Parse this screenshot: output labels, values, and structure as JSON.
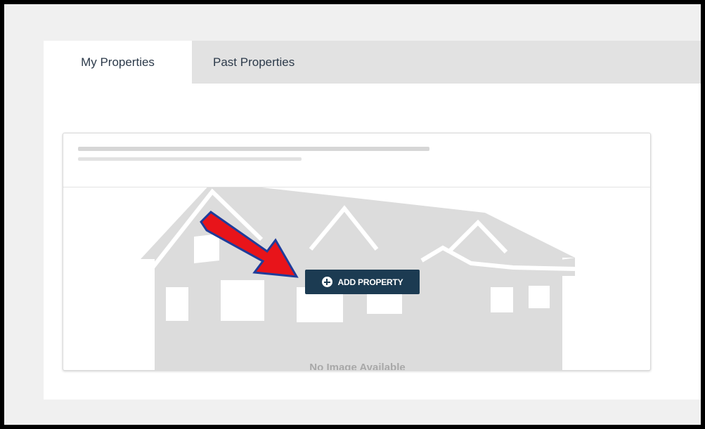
{
  "tabs": {
    "my_properties": "My Properties",
    "past_properties": "Past Properties"
  },
  "card": {
    "add_button_label": "ADD PROPERTY",
    "add_button_icon": "plus-circle-icon",
    "no_image_text": "No Image Available"
  },
  "annotation": {
    "arrow_color": "#e8141a",
    "arrow_outline": "#1f3c9a"
  },
  "colors": {
    "button_bg": "#1c3b52",
    "tab_bar_bg": "#e2e2e2",
    "house_placeholder": "#dcdcdc"
  }
}
